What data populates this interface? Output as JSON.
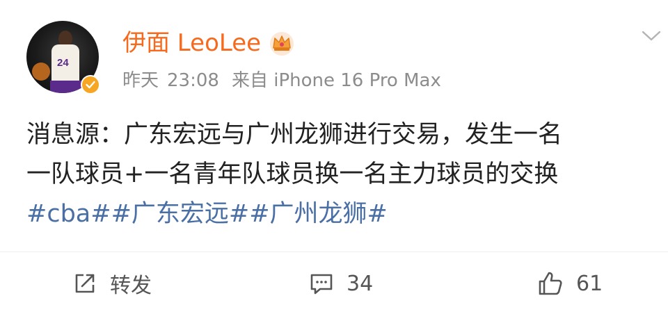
{
  "post": {
    "username": "伊面 LeoLee",
    "meta": {
      "time_day": "昨天",
      "time_clock": "23:08",
      "source": "来自 iPhone 16 Pro Max"
    },
    "avatar": {
      "jersey_number": "24"
    },
    "content_lines": [
      "消息源：广东宏远与广州龙狮进行交易，发生一名",
      "一队球员+一名青年队球员换一名主力球员的交换"
    ],
    "hashtags": [
      "#cba#",
      "#广东宏远#",
      "#广州龙狮#"
    ]
  },
  "actions": {
    "repost_label": "转发",
    "comment_count": "34",
    "like_count": "61"
  },
  "icons": {
    "crown": "crown-icon",
    "verified": "verified-badge-icon",
    "chevron": "chevron-down-icon",
    "repost": "share-icon",
    "comment": "comment-icon",
    "like": "thumbs-up-icon"
  },
  "colors": {
    "username": "#f56a1d",
    "meta": "#8c8c8c",
    "hashtag": "#4a6fa5",
    "text": "#222222",
    "verified": "#f6a623"
  }
}
